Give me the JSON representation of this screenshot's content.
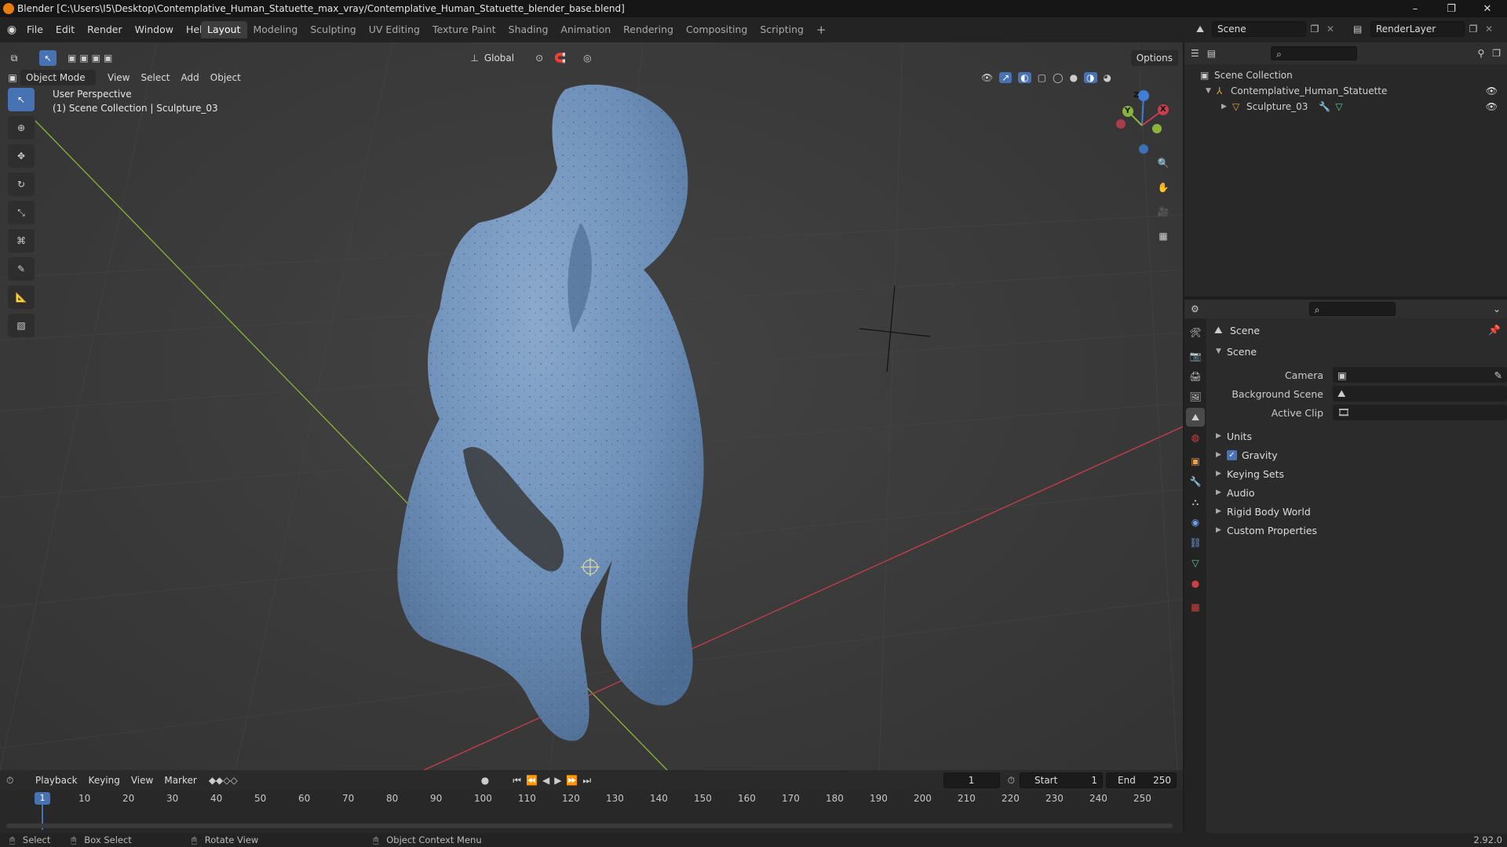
{
  "window": {
    "title": "Blender [C:\\Users\\I5\\Desktop\\Contemplative_Human_Statuette_max_vray/Contemplative_Human_Statuette_blender_base.blend]",
    "controls": [
      "–",
      "❐",
      "✕"
    ]
  },
  "menu": [
    "File",
    "Edit",
    "Render",
    "Window",
    "Help"
  ],
  "workspaces": [
    "Layout",
    "Modeling",
    "Sculpting",
    "UV Editing",
    "Texture Paint",
    "Shading",
    "Animation",
    "Rendering",
    "Compositing",
    "Scripting"
  ],
  "workspace_add": "+",
  "scene_selector": {
    "value": "Scene"
  },
  "renderlayer_selector": {
    "value": "RenderLayer"
  },
  "toolbar": {
    "transform_orientation": "Global",
    "options_label": "Options"
  },
  "viewport": {
    "mode": "Object Mode",
    "menus": [
      "View",
      "Select",
      "Add",
      "Object"
    ],
    "overlay_line1": "User Perspective",
    "overlay_line2": "(1) Scene Collection | Sculpture_03",
    "gizmo_axes": {
      "x": "X",
      "y": "Y",
      "z": "Z"
    },
    "colors": {
      "x_axis": "#c73e4e",
      "y_axis": "#8bb53a",
      "z_axis": "#3f7ed6",
      "mesh": "#6d8fb8"
    }
  },
  "outliner": {
    "root": "Scene Collection",
    "items": [
      {
        "label": "Contemplative_Human_Statuette"
      },
      {
        "label": "Sculpture_03"
      }
    ]
  },
  "properties": {
    "header": "Scene",
    "panel": "Scene",
    "fields": [
      {
        "label": "Camera",
        "value": ""
      },
      {
        "label": "Background Scene",
        "value": ""
      },
      {
        "label": "Active Clip",
        "value": ""
      }
    ],
    "sections": [
      "Units",
      "Gravity",
      "Keying Sets",
      "Audio",
      "Rigid Body World",
      "Custom Properties"
    ],
    "gravity_checked": true
  },
  "timeline": {
    "menus": [
      "Playback",
      "Keying",
      "View",
      "Marker"
    ],
    "current_frame": "1",
    "start_label": "Start",
    "start_value": "1",
    "end_label": "End",
    "end_value": "250",
    "ruler": [
      "10",
      "20",
      "30",
      "40",
      "50",
      "60",
      "70",
      "80",
      "90",
      "100",
      "110",
      "120",
      "130",
      "140",
      "150",
      "160",
      "170",
      "180",
      "190",
      "200",
      "210",
      "220",
      "230",
      "240",
      "250"
    ],
    "playhead": "1"
  },
  "statusbar": {
    "select": "Select",
    "box_select": "Box Select",
    "rotate_view": "Rotate View",
    "context_menu": "Object Context Menu",
    "version": "2.92.0"
  }
}
